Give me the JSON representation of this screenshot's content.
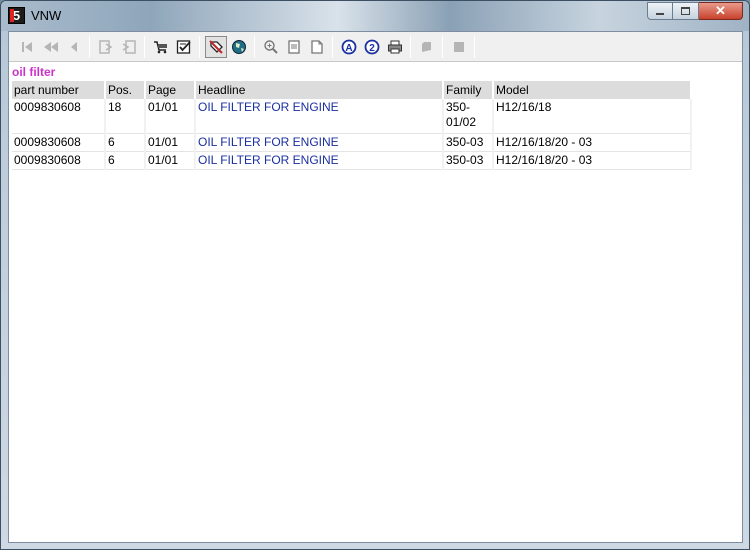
{
  "window": {
    "title": "VNW",
    "app_icon": "app-logo-icon"
  },
  "toolbar": {
    "buttons": [
      {
        "name": "first-page-icon",
        "enabled": false
      },
      {
        "name": "previous-pages-icon",
        "enabled": false
      },
      {
        "name": "previous-page-icon",
        "enabled": false
      },
      {
        "name": "export-icon",
        "enabled": false
      },
      {
        "name": "import-icon",
        "enabled": false
      },
      {
        "name": "cart-icon",
        "enabled": true
      },
      {
        "name": "checklist-icon",
        "enabled": true
      },
      {
        "name": "tag-icon",
        "enabled": true,
        "pressed": true
      },
      {
        "name": "globe-icon",
        "enabled": true
      },
      {
        "name": "zoom-in-icon",
        "enabled": true
      },
      {
        "name": "page-icon",
        "enabled": true
      },
      {
        "name": "page-fold-icon",
        "enabled": true
      },
      {
        "name": "circle-a-icon",
        "enabled": true
      },
      {
        "name": "circle-2-icon",
        "enabled": true
      },
      {
        "name": "print-icon",
        "enabled": true
      },
      {
        "name": "stamp-icon",
        "enabled": false
      },
      {
        "name": "stop-icon",
        "enabled": false
      }
    ]
  },
  "search": {
    "query": "oil filter"
  },
  "results": {
    "columns": [
      "part number",
      "Pos.",
      "Page",
      "Headline",
      "Family",
      "Model"
    ],
    "rows": [
      {
        "part_number": "0009830608",
        "pos": "18",
        "page": "01/01",
        "headline": "OIL FILTER FOR ENGINE",
        "family": "350-01/02",
        "model": "H12/16/18"
      },
      {
        "part_number": "0009830608",
        "pos": "6",
        "page": "01/01",
        "headline": "OIL FILTER FOR ENGINE",
        "family": "350-03",
        "model": "H12/16/18/20 - 03"
      },
      {
        "part_number": "0009830608",
        "pos": "6",
        "page": "01/01",
        "headline": "OIL FILTER FOR ENGINE",
        "family": "350-03",
        "model": "H12/16/18/20 - 03"
      }
    ]
  },
  "colors": {
    "query_text": "#cc33cc",
    "headline_link": "#1a2fa0",
    "header_bg": "#dcdcdc"
  }
}
